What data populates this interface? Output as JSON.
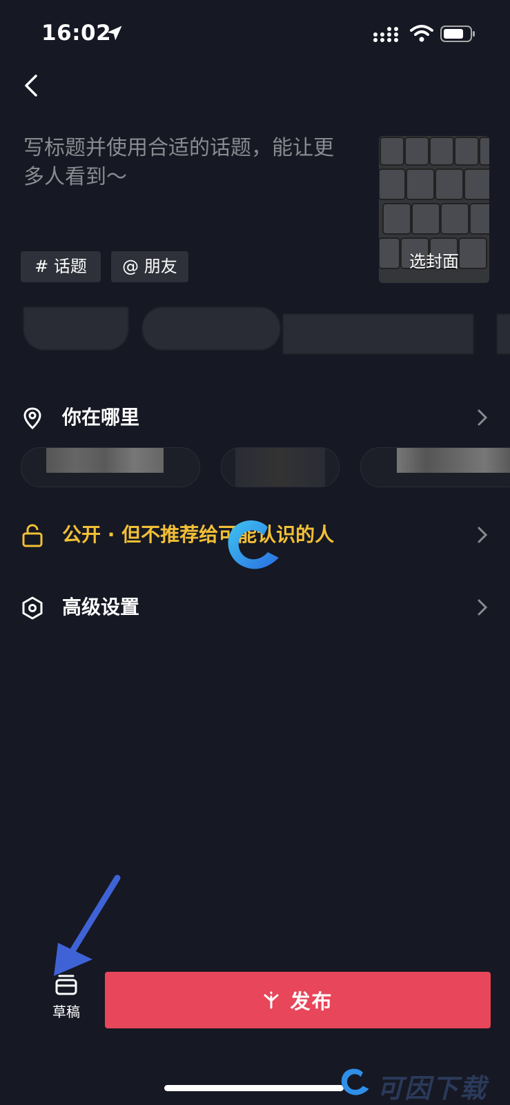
{
  "status_bar": {
    "time": "16:02"
  },
  "post": {
    "caption_placeholder": "写标题并使用合适的话题，能让更多人看到～",
    "cover_label": "选封面",
    "chips": {
      "topic": "# 话题",
      "friend": "@ 朋友"
    }
  },
  "rows": {
    "location": "你在哪里",
    "privacy": "公开 · 但不推荐给可能认识的人",
    "advanced": "高级设置"
  },
  "bottom": {
    "draft_label": "草稿",
    "publish_label": "发布"
  },
  "watermark": {
    "text": "可因下载"
  },
  "colors": {
    "background": "#161823",
    "publish": "#e8465a",
    "privacy_text": "#f2c036",
    "annotation_arrow": "#3f63d6"
  },
  "icons": {
    "back": "chevron-left-icon",
    "location": "location-pin-icon",
    "privacy": "unlock-icon",
    "advanced": "hexagon-settings-icon",
    "draft": "draft-box-icon",
    "publish": "sparkle-icon"
  }
}
